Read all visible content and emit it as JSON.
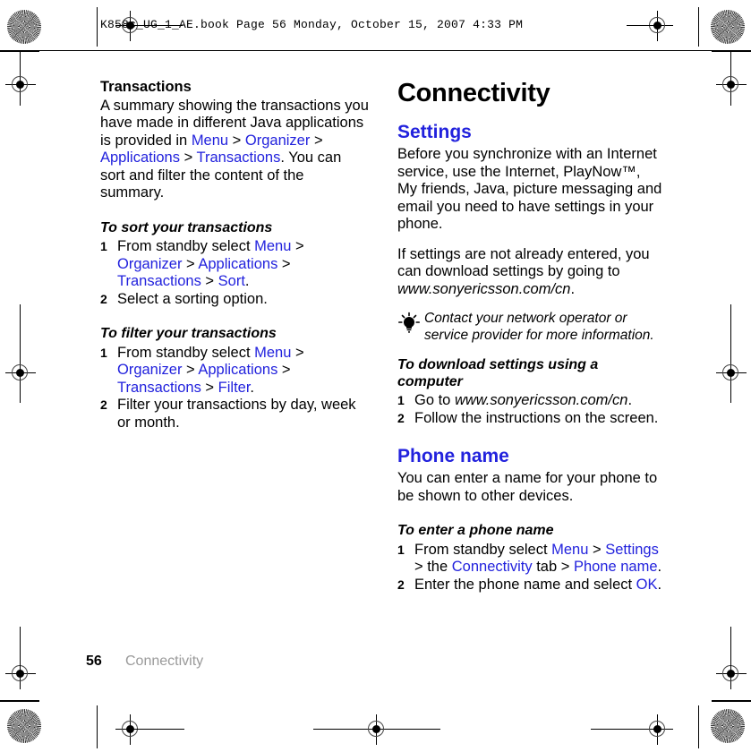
{
  "print_marks": {
    "slug_line": "K858c_UG_1_AE.book  Page 56  Monday, October 15, 2007  4:33 PM"
  },
  "left_column": {
    "subhead": "Transactions",
    "intro": {
      "part1": "A summary showing the transactions you have made in different Java applications is provided in ",
      "link1": "Menu",
      "sep1": " > ",
      "link2": "Organizer",
      "sep2": " > ",
      "link3": "Applications",
      "sep3": " > ",
      "link4": "Transactions",
      "part2": ". You can sort and filter the content of the summary."
    },
    "task_sort": {
      "title": "To sort your transactions",
      "step1": {
        "text_a": "From standby select ",
        "link1": "Menu",
        "sep1": " > ",
        "link2": "Organizer",
        "sep2": " > ",
        "link3": "Applications",
        "sep3": " > ",
        "link4": "Transactions",
        "sep4": " > ",
        "link5": "Sort",
        "text_b": "."
      },
      "step2": "Select a sorting option."
    },
    "task_filter": {
      "title": "To filter your transactions",
      "step1": {
        "text_a": "From standby select ",
        "link1": "Menu",
        "sep1": " > ",
        "link2": "Organizer",
        "sep2": " > ",
        "link3": "Applications",
        "sep3": " > ",
        "link4": "Transactions",
        "sep4": " > ",
        "link5": "Filter",
        "text_b": "."
      },
      "step2": "Filter your transactions by day, week or month."
    }
  },
  "right_column": {
    "chapter_title": "Connectivity",
    "settings": {
      "heading": "Settings",
      "para1": "Before you synchronize with an Internet service, use the Internet, PlayNow™, My friends, Java, picture messaging and email you need to have settings in your phone.",
      "para2_a": "If settings are not already entered, you can download settings by going to ",
      "para2_url": "www.sonyericsson.com/cn",
      "para2_b": ".",
      "tip": "Contact your network operator or service provider for more information.",
      "task_download": {
        "title": "To download settings using a computer",
        "step1_a": "Go to ",
        "step1_url": "www.sonyericsson.com/cn",
        "step1_b": ".",
        "step2": "Follow the instructions on the screen."
      }
    },
    "phone_name": {
      "heading": "Phone name",
      "para": "You can enter a name for your phone to be shown to other devices.",
      "task": {
        "title": "To enter a phone name",
        "step1": {
          "text_a": "From standby select ",
          "link1": "Menu",
          "sep1": " > ",
          "link2": "Settings",
          "sep2": " > the ",
          "link3": "Connectivity",
          "sep3": " tab > ",
          "link4": "Phone name",
          "text_b": "."
        },
        "step2_a": "Enter the phone name and select ",
        "step2_link": "OK",
        "step2_b": "."
      }
    }
  },
  "footer": {
    "page_number": "56",
    "chapter_name": "Connectivity"
  },
  "colors": {
    "link_blue": "#2222dd",
    "footer_gray": "#9a9a9a",
    "text_black": "#000000"
  }
}
